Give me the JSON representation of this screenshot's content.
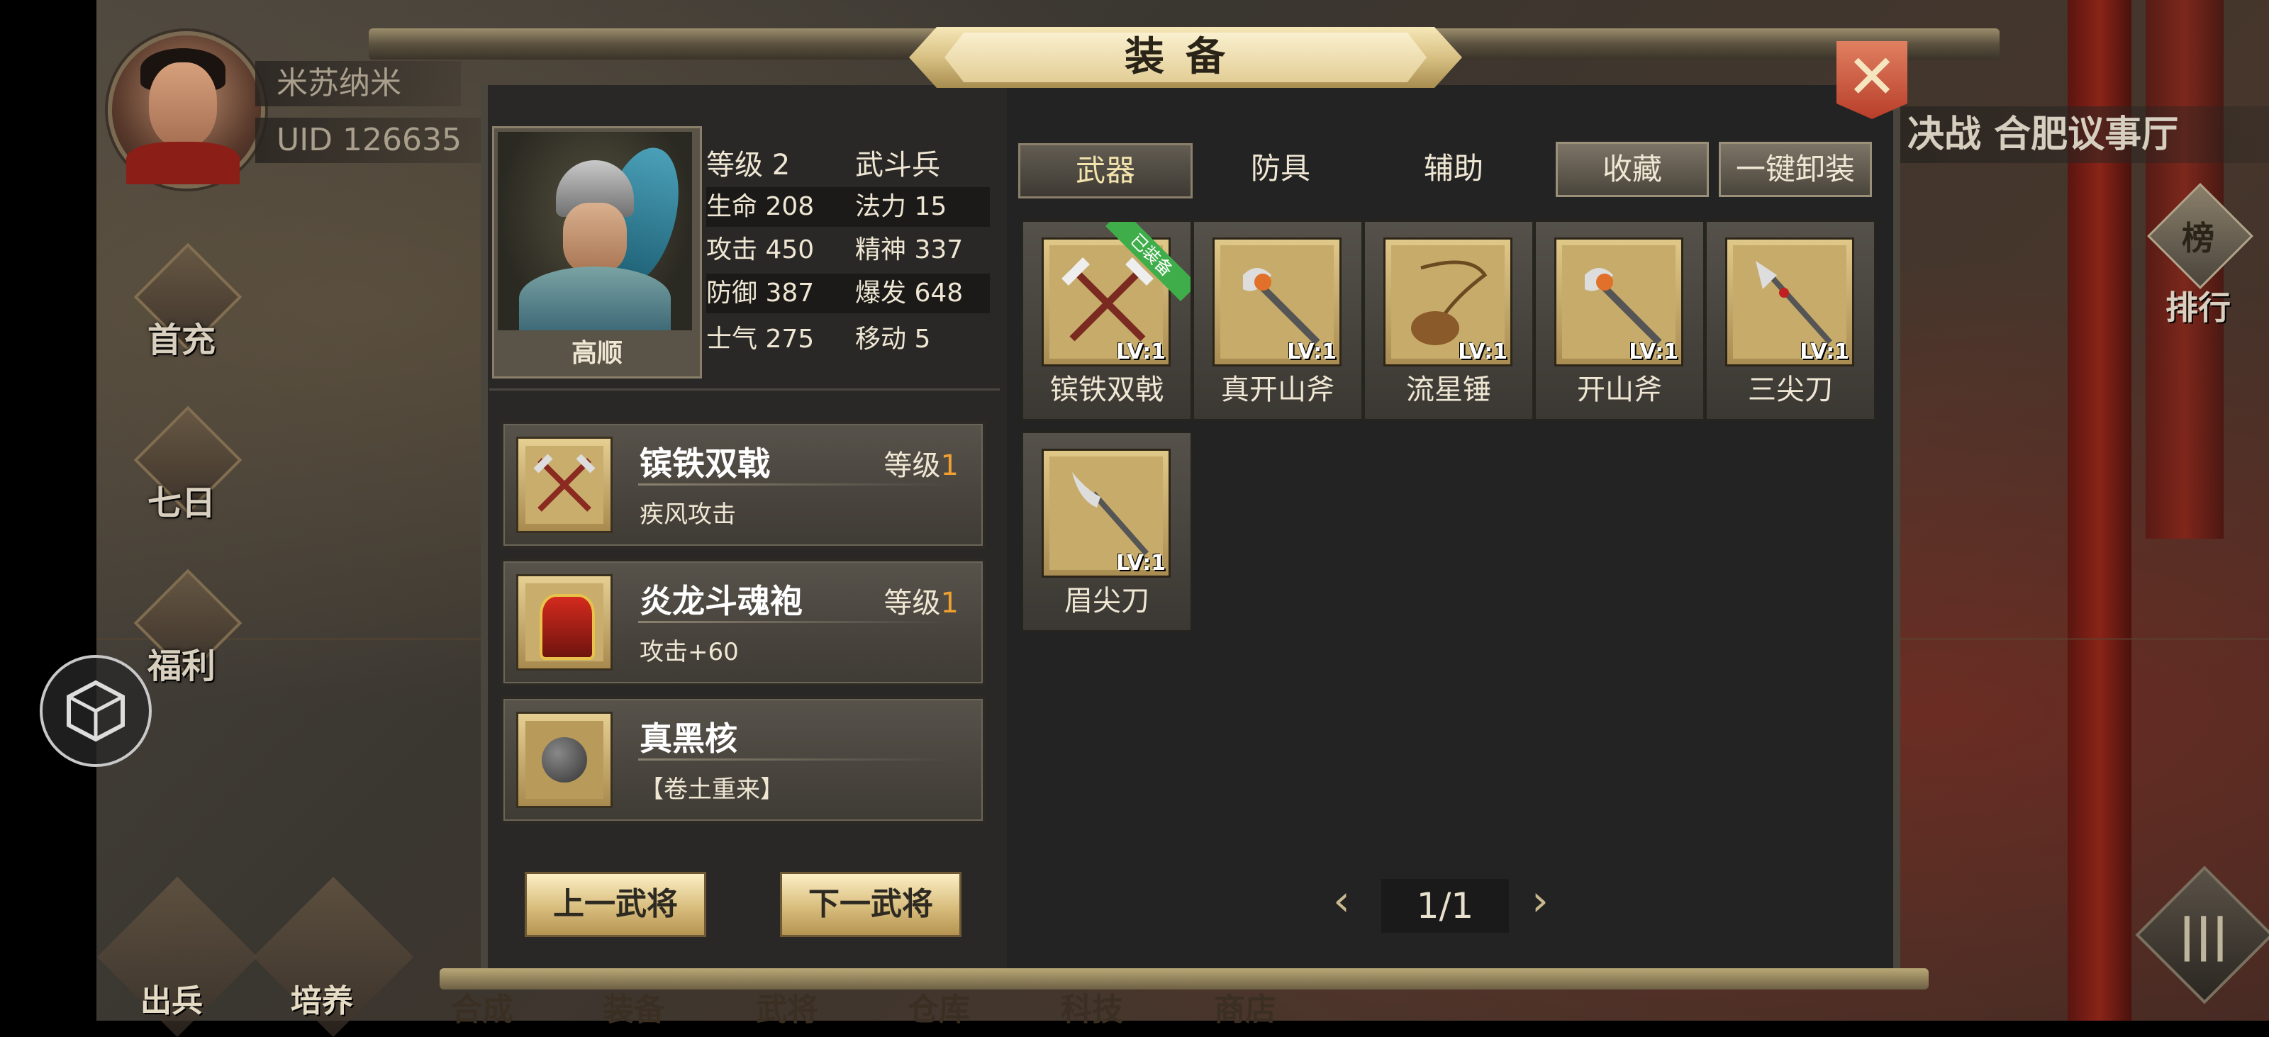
{
  "player": {
    "name": "米苏纳米",
    "uid": "UID  126635"
  },
  "side_menu": [
    "首充",
    "七日",
    "福利"
  ],
  "bottom_menu": [
    "出兵",
    "培养",
    "合成",
    "装备",
    "武将",
    "仓库",
    "科技",
    "商店"
  ],
  "right_info": {
    "location": "决战 合肥议事厅",
    "rank_label": "排行",
    "rank_icon_text": "榜"
  },
  "dialog": {
    "title": "装备",
    "close": "✕"
  },
  "hero": {
    "name": "高顺",
    "stats": [
      {
        "k": "等级",
        "v": "2",
        "k2": "武斗兵",
        "v2": ""
      },
      {
        "k": "生命",
        "v": "208",
        "k2": "法力",
        "v2": "15"
      },
      {
        "k": "攻击",
        "v": "450",
        "k2": "精神",
        "v2": "337"
      },
      {
        "k": "防御",
        "v": "387",
        "k2": "爆发",
        "v2": "648"
      },
      {
        "k": "士气",
        "v": "275",
        "k2": "移动",
        "v2": "5"
      }
    ]
  },
  "equipped": [
    {
      "name": "镔铁双戟",
      "level_label": "等级",
      "level": "1",
      "desc": "疾风攻击"
    },
    {
      "name": "炎龙斗魂袍",
      "level_label": "等级",
      "level": "1",
      "desc": "攻击+60"
    },
    {
      "name": "真黑核",
      "level_label": "",
      "level": "",
      "desc": "【卷土重来】"
    }
  ],
  "buttons": {
    "prev": "上一武将",
    "next": "下一武将"
  },
  "tabs": [
    {
      "label": "武器",
      "active": true
    },
    {
      "label": "防具",
      "active": false
    },
    {
      "label": "辅助",
      "active": false
    }
  ],
  "actions": {
    "collect": "收藏",
    "unequip_all": "一键卸装"
  },
  "inventory": [
    {
      "name": "镔铁双戟",
      "lv": "LV:1",
      "equipped_tag": "已装备",
      "icon": "twin-halberd-icon"
    },
    {
      "name": "真开山斧",
      "lv": "LV:1",
      "equipped_tag": "",
      "icon": "axe-icon"
    },
    {
      "name": "流星锤",
      "lv": "LV:1",
      "equipped_tag": "",
      "icon": "meteor-hammer-icon"
    },
    {
      "name": "开山斧",
      "lv": "LV:1",
      "equipped_tag": "",
      "icon": "axe-icon"
    },
    {
      "name": "三尖刀",
      "lv": "LV:1",
      "equipped_tag": "",
      "icon": "trident-blade-icon"
    },
    {
      "name": "眉尖刀",
      "lv": "LV:1",
      "equipped_tag": "",
      "icon": "glaive-icon"
    }
  ],
  "pager": {
    "text": "1/1",
    "prev": "‹",
    "next": "›"
  },
  "colors": {
    "accent_gold": "#d8bd7d",
    "level_orange": "#f0a030",
    "close_red": "#c4492f",
    "equipped_green": "#3fae4a"
  }
}
